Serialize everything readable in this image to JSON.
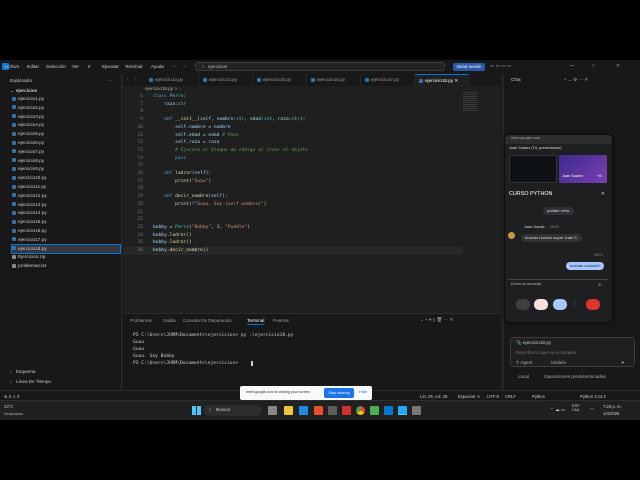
{
  "menu": [
    "Archivo",
    "Editar",
    "Selección",
    "Ver",
    "Ir",
    "Ejecutar",
    "Terminal",
    "Ayuda"
  ],
  "search": {
    "text": "ejercicios"
  },
  "login_button": "Iniciar sesión",
  "sidebar": {
    "title": "Explorador",
    "root": "ejercicios",
    "files": [
      "ejercicio1.py",
      "ejercicio2.py",
      "ejercicio3.py",
      "ejercicio4.py",
      "ejercicio5.py",
      "ejercicio6.py",
      "ejercicio7.py",
      "ejercicio8.py",
      "ejercicio9.py",
      "ejercicio10.py",
      "ejercicio11.py",
      "ejercicio12.py",
      "ejercicio13.py",
      "ejercicio14.py",
      "ejercicio15.py",
      "ejercicio16.py",
      "ejercicio17.py",
      "ejercicio18.py",
      "Ejercicios.zip",
      "problemas.txt"
    ],
    "active_file": "ejercicio18.py",
    "outline": "Esquema",
    "timeline": "Línea De Tiempo"
  },
  "tabs": [
    "ejercicio13.py",
    "ejercicio14.py",
    "ejercicio15.py",
    "ejercicio16.py",
    "ejercicio17.py",
    "ejercicio18.py"
  ],
  "active_tab": "ejercicio18.py",
  "breadcrumb": "ejercicio18.py > ...",
  "code": [
    {
      "n": "6",
      "tokens": [
        [
          "kw",
          "class "
        ],
        [
          "cl",
          "Perro"
        ],
        [
          "op",
          ":"
        ]
      ]
    },
    {
      "n": "7",
      "tokens": [
        [
          "id",
          "    raza"
        ],
        [
          "op",
          ":"
        ],
        [
          "cl",
          "str"
        ]
      ]
    },
    {
      "n": "8",
      "tokens": []
    },
    {
      "n": "9",
      "tokens": [
        [
          "kw",
          "    def "
        ],
        [
          "fn",
          "__init__"
        ],
        [
          "op",
          "("
        ],
        [
          "id",
          "self"
        ],
        [
          "op",
          ", "
        ],
        [
          "id",
          "nombre"
        ],
        [
          "op",
          ":"
        ],
        [
          "cl",
          "str"
        ],
        [
          "op",
          ", "
        ],
        [
          "id",
          "edad"
        ],
        [
          "op",
          ":"
        ],
        [
          "cl",
          "int"
        ],
        [
          "op",
          ", "
        ],
        [
          "id",
          "raza"
        ],
        [
          "op",
          ":"
        ],
        [
          "cl",
          "str"
        ],
        [
          "op",
          "):"
        ]
      ]
    },
    {
      "n": "10",
      "tokens": [
        [
          "id",
          "        self"
        ],
        [
          "op",
          "."
        ],
        [
          "id",
          "nombre"
        ],
        [
          "op",
          " = "
        ],
        [
          "id",
          "nombre"
        ]
      ]
    },
    {
      "n": "11",
      "tokens": [
        [
          "id",
          "        self"
        ],
        [
          "op",
          "."
        ],
        [
          "id",
          "edad"
        ],
        [
          "op",
          " = "
        ],
        [
          "id",
          "edad"
        ],
        [
          "cm",
          " # Años"
        ]
      ]
    },
    {
      "n": "12",
      "tokens": [
        [
          "id",
          "        self"
        ],
        [
          "op",
          "."
        ],
        [
          "id",
          "raza"
        ],
        [
          "op",
          " = "
        ],
        [
          "id",
          "raza"
        ]
      ]
    },
    {
      "n": "13",
      "tokens": [
        [
          "cm",
          "        # Ejecuta el bloque de código al crear el objeto"
        ]
      ]
    },
    {
      "n": "14",
      "tokens": [
        [
          "kw",
          "        pass"
        ]
      ]
    },
    {
      "n": "15",
      "tokens": []
    },
    {
      "n": "16",
      "tokens": [
        [
          "kw",
          "    def "
        ],
        [
          "fn",
          "ladrar"
        ],
        [
          "op",
          "("
        ],
        [
          "id",
          "self"
        ],
        [
          "op",
          "):"
        ]
      ]
    },
    {
      "n": "17",
      "tokens": [
        [
          "fn",
          "        print"
        ],
        [
          "op",
          "("
        ],
        [
          "st",
          "\"Guau\""
        ],
        [
          "op",
          ")"
        ]
      ]
    },
    {
      "n": "18",
      "tokens": []
    },
    {
      "n": "19",
      "tokens": [
        [
          "kw",
          "    def "
        ],
        [
          "fn",
          "decir_nombre"
        ],
        [
          "op",
          "("
        ],
        [
          "id",
          "self"
        ],
        [
          "op",
          "):"
        ]
      ]
    },
    {
      "n": "20",
      "tokens": [
        [
          "fn",
          "        print"
        ],
        [
          "op",
          "("
        ],
        [
          "kw",
          "f"
        ],
        [
          "st",
          "\"Guau. Soy {self.nombre}\""
        ],
        [
          "op",
          ")"
        ]
      ]
    },
    {
      "n": "21",
      "tokens": []
    },
    {
      "n": "22",
      "tokens": []
    },
    {
      "n": "23",
      "tokens": [
        [
          "id",
          "bobby"
        ],
        [
          "op",
          " = "
        ],
        [
          "cl",
          "Perro"
        ],
        [
          "op",
          "("
        ],
        [
          "st",
          "\"Bobby\""
        ],
        [
          "op",
          ", "
        ],
        [
          "nu",
          "3"
        ],
        [
          "op",
          ", "
        ],
        [
          "st",
          "\"Puddle\""
        ],
        [
          "op",
          ")"
        ]
      ]
    },
    {
      "n": "24",
      "tokens": [
        [
          "id",
          "bobby"
        ],
        [
          "op",
          "."
        ],
        [
          "fn",
          "ladrar"
        ],
        [
          "op",
          "()"
        ]
      ]
    },
    {
      "n": "25",
      "tokens": [
        [
          "id",
          "bobby"
        ],
        [
          "op",
          "."
        ],
        [
          "fn",
          "ladrar"
        ],
        [
          "op",
          "()"
        ]
      ]
    },
    {
      "n": "26",
      "tokens": [
        [
          "id",
          "bobby"
        ],
        [
          "op",
          "."
        ],
        [
          "fn",
          "decir_nombre"
        ],
        [
          "op",
          "()"
        ]
      ]
    }
  ],
  "panel_tabs": [
    "Problemas",
    "Salida",
    "Consola De Depuración",
    "Terminal",
    "Puertos"
  ],
  "active_panel_tab": "Terminal",
  "terminal": [
    "PS C:\\Users\\JURM\\Documents\\ejercicios> py .\\ejercicio18.py",
    "Guau",
    "Guau",
    "Guau. Soy Bobby",
    "PS C:\\Users\\JURM\\Documents\\ejercicios> "
  ],
  "chat": {
    "header": "Chat",
    "meet_url": "meet.google.com",
    "presenter": "Juan Suarez (Tú, presentando)",
    "tile_name": "Juan Suarez",
    "more_count": "+8",
    "title": "CURSO PYTHON",
    "messages": [
      {
        "from": "",
        "time": "",
        "text": "podrán verlo."
      },
      {
        "from": "Juan Garcia",
        "time": "19:12",
        "text": "buenas noches super Juan S."
      },
      {
        "from": "",
        "time": "19:12",
        "text": "buenas noches!!!"
      }
    ],
    "input_placeholder": "Envía un mensaje",
    "copilot_file": "ejercicio18.py",
    "copilot_placeholder": "Describa lo que va a compilar",
    "agent_label": "Agent",
    "mode_label": "Modelo",
    "local_label": "Local",
    "options_label": "Operaciones predeterminadas"
  },
  "statusbar": {
    "errors": "0",
    "warnings": "0",
    "position": "Lín. 25, col. 28",
    "spaces": "Espacios: 4",
    "encoding": "UTF-8",
    "eol": "CRLF",
    "language": "Python",
    "interpreter": "Python 3.14.2"
  },
  "share_bar": {
    "text": "meet.google.com is sharing your screen.",
    "stop": "Stop sharing",
    "hide": "Hide"
  },
  "taskbar": {
    "weather_temp": "23°C",
    "weather_text": "Despejado",
    "search": "Buscar",
    "lang": "ESP LAA",
    "time": "7:26 p. m.",
    "date": "1/4/2026"
  },
  "colors": {
    "accent": "#0078d4",
    "editor_bg": "#1f1f1f",
    "panel_bg": "#181818"
  }
}
